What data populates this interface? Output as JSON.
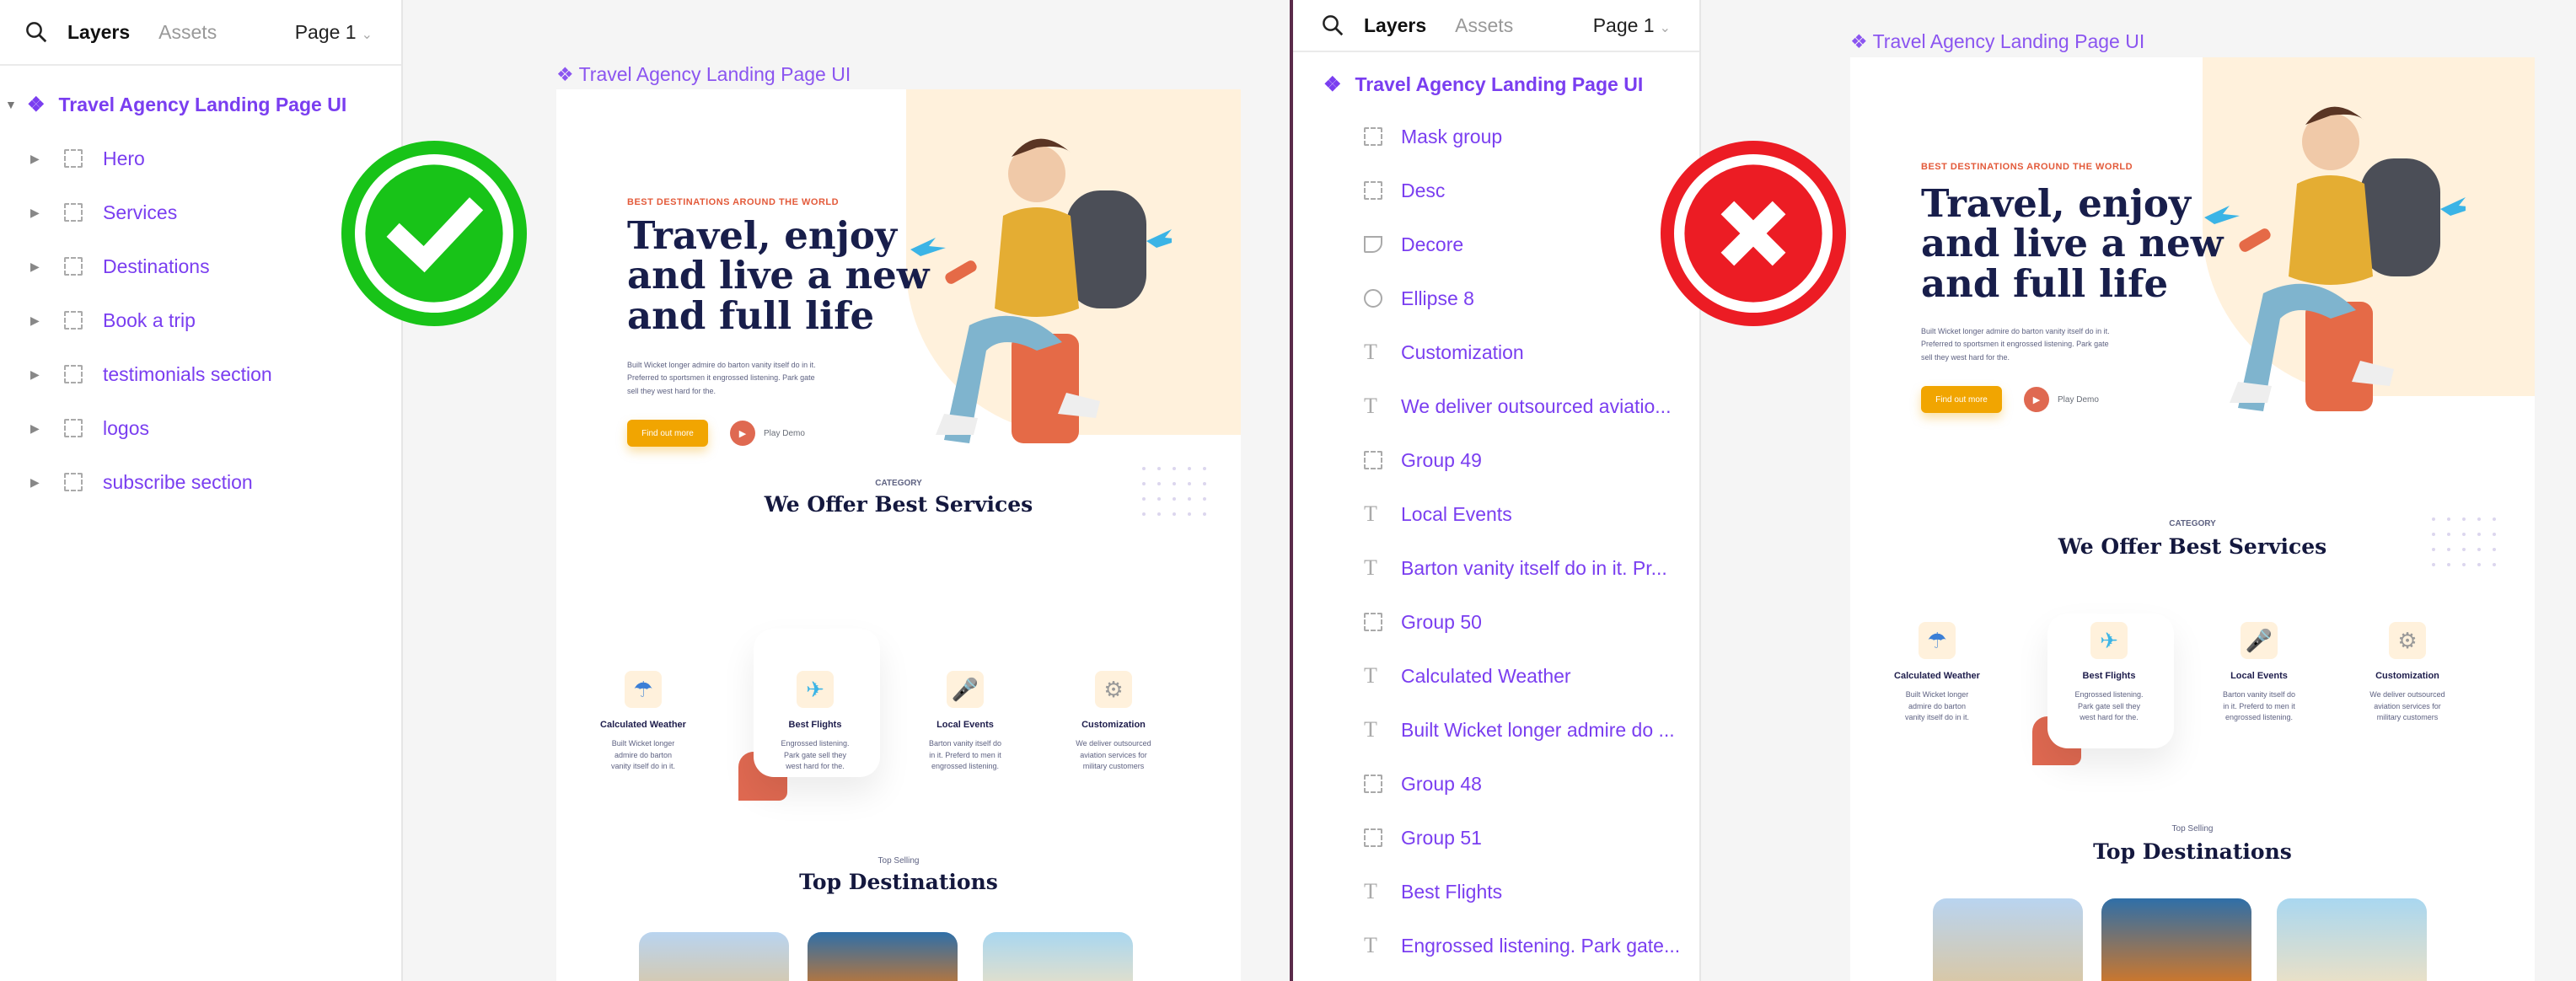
{
  "colors": {
    "accent": "#7a3ef0",
    "ok": "#18c318",
    "bad": "#ec1c24",
    "orange": "#f1a501",
    "coral": "#df6951",
    "navy": "#181e4b"
  },
  "left": {
    "search_icon": "search-icon",
    "tabs": {
      "layers": "Layers",
      "assets": "Assets"
    },
    "page_selector": "Page 1",
    "root_label": "Travel Agency Landing Page UI",
    "layers": [
      "Hero",
      "Services",
      "Destinations",
      "Book a trip",
      "testimonials section",
      "logos",
      "subscribe section"
    ],
    "frame_title": "Travel Agency Landing Page UI",
    "verdict_icon": "checkmark-icon"
  },
  "right": {
    "tabs": {
      "layers": "Layers",
      "assets": "Assets"
    },
    "page_selector": "Page 1",
    "root_label": "Travel Agency Landing Page UI",
    "layers": [
      {
        "type": "frame",
        "label": "Mask group"
      },
      {
        "type": "frame",
        "label": "Desc"
      },
      {
        "type": "decor",
        "label": "Decore"
      },
      {
        "type": "ellipse",
        "label": "Ellipse 8"
      },
      {
        "type": "text",
        "label": "Customization"
      },
      {
        "type": "text",
        "label": "We deliver outsourced aviatio..."
      },
      {
        "type": "frame",
        "label": "Group 49"
      },
      {
        "type": "text",
        "label": "Local Events"
      },
      {
        "type": "text",
        "label": "Barton vanity itself do in it. Pr..."
      },
      {
        "type": "frame",
        "label": "Group 50"
      },
      {
        "type": "text",
        "label": "Calculated Weather"
      },
      {
        "type": "text",
        "label": "Built Wicket longer admire do ..."
      },
      {
        "type": "frame",
        "label": "Group 48"
      },
      {
        "type": "frame",
        "label": "Group 51"
      },
      {
        "type": "text",
        "label": "Best Flights"
      },
      {
        "type": "text",
        "label": "Engrossed listening. Park gate..."
      }
    ],
    "frame_title": "Travel Agency Landing Page UI",
    "verdict_icon": "x-mark-icon"
  },
  "design": {
    "eyebrow": "BEST DESTINATIONS AROUND THE WORLD",
    "headline": [
      "Travel, enjoy",
      "and live a new",
      "and full life"
    ],
    "body": [
      "Built Wicket longer admire do barton vanity itself do in it.",
      "Preferred to sportsmen it engrossed listening. Park gate",
      "sell they west hard for the."
    ],
    "cta": "Find out more",
    "play": "Play Demo",
    "category": "CATEGORY",
    "services_title": "We Offer Best Services",
    "services": [
      {
        "title": "Calculated Weather",
        "desc": [
          "Built Wicket longer",
          "admire do barton",
          "vanity itself do in it."
        ],
        "icon": "weather-icon"
      },
      {
        "title": "Best Flights",
        "desc": [
          "Engrossed listening.",
          "Park gate sell they",
          "west hard for the."
        ],
        "icon": "plane-icon"
      },
      {
        "title": "Local Events",
        "desc": [
          "Barton vanity itself do",
          "in it. Preferd to men it",
          "engrossed listening."
        ],
        "icon": "microphone-icon"
      },
      {
        "title": "Customization",
        "desc": [
          "We deliver outsourced",
          "aviation services for",
          "military customers"
        ],
        "icon": "gear-icon"
      }
    ],
    "top_selling": "Top Selling",
    "dest_title": "Top Destinations"
  }
}
